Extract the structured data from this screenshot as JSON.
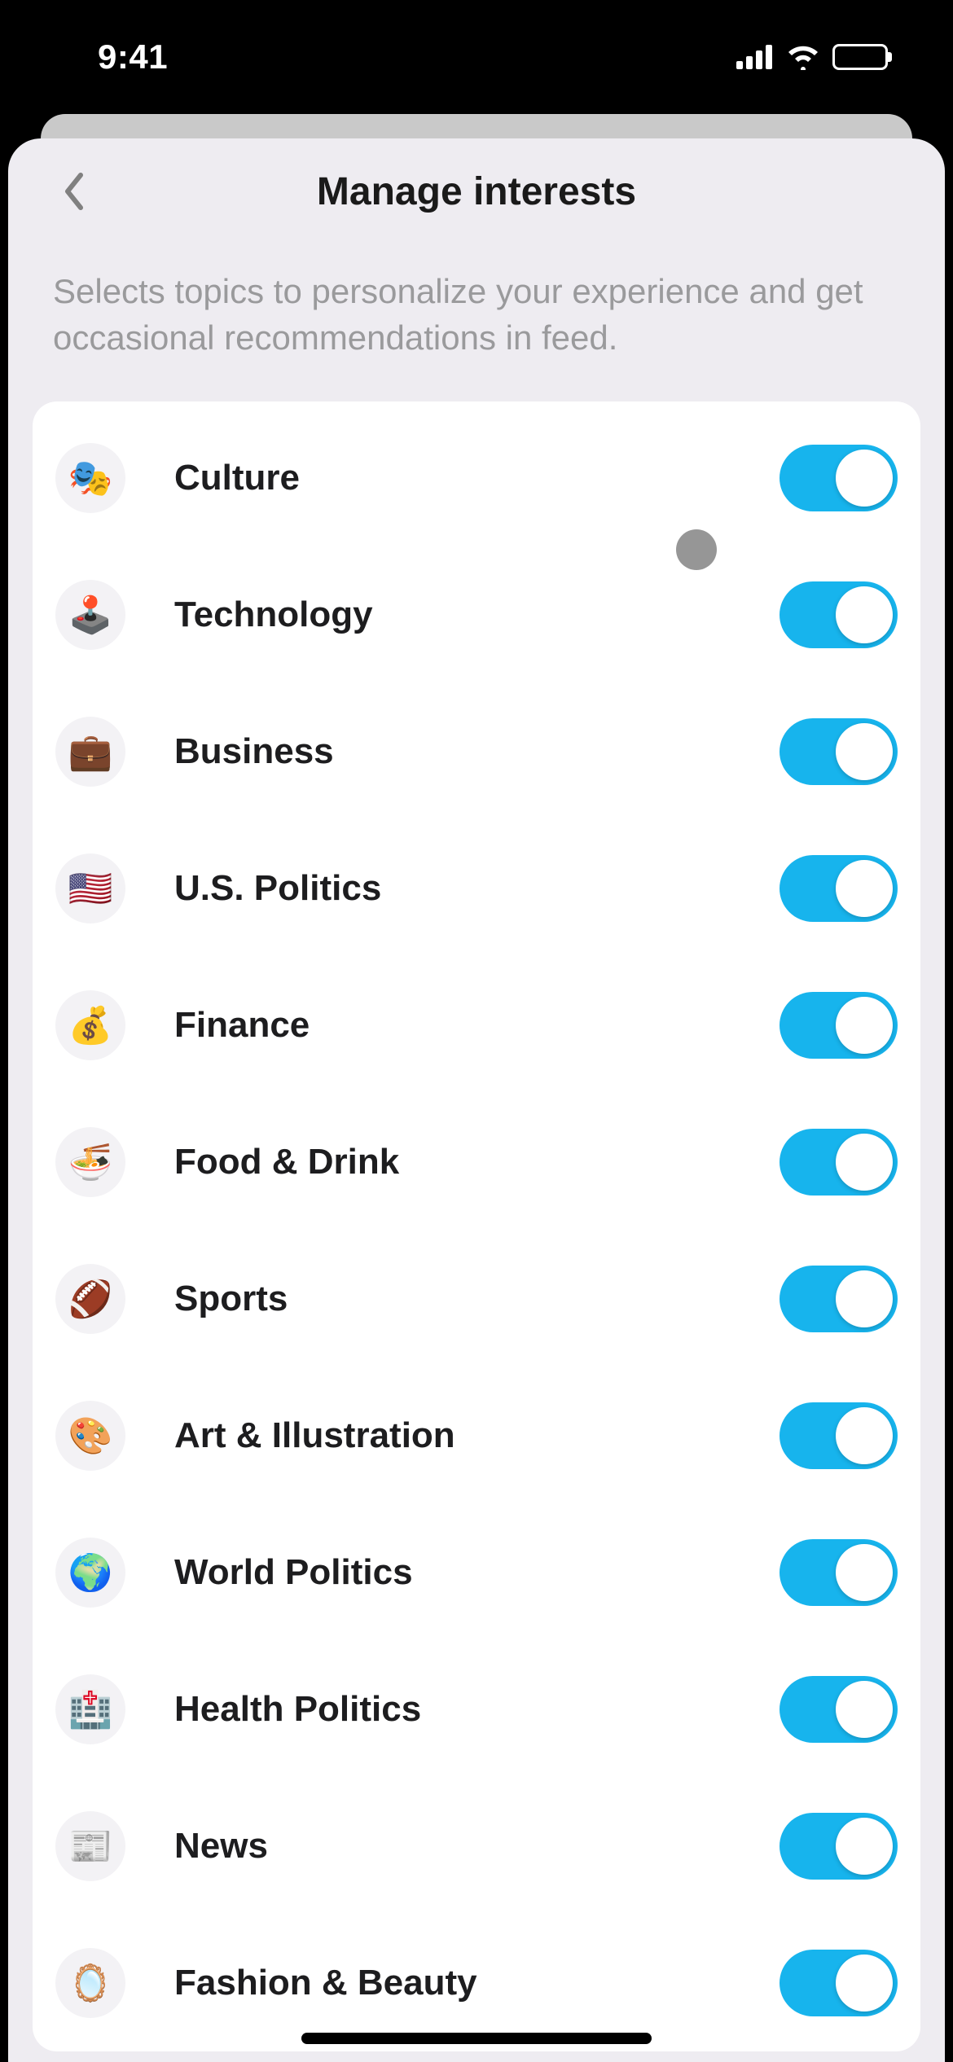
{
  "status": {
    "time": "9:41"
  },
  "header": {
    "title": "Manage interests"
  },
  "description": "Selects topics to personalize your experience and get occasional recommendations in feed.",
  "interests": [
    {
      "icon": "🎭",
      "label": "Culture",
      "on": true
    },
    {
      "icon": "🕹️",
      "label": "Technology",
      "on": true
    },
    {
      "icon": "💼",
      "label": "Business",
      "on": true
    },
    {
      "icon": "🇺🇸",
      "label": "U.S. Politics",
      "on": true
    },
    {
      "icon": "💰",
      "label": "Finance",
      "on": true
    },
    {
      "icon": "🍜",
      "label": "Food & Drink",
      "on": true
    },
    {
      "icon": "🏈",
      "label": "Sports",
      "on": true
    },
    {
      "icon": "🎨",
      "label": "Art & Illustration",
      "on": true
    },
    {
      "icon": "🌍",
      "label": "World Politics",
      "on": true
    },
    {
      "icon": "🏥",
      "label": "Health Politics",
      "on": true
    },
    {
      "icon": "📰",
      "label": "News",
      "on": true
    },
    {
      "icon": "🪞",
      "label": "Fashion & Beauty",
      "on": true
    }
  ]
}
